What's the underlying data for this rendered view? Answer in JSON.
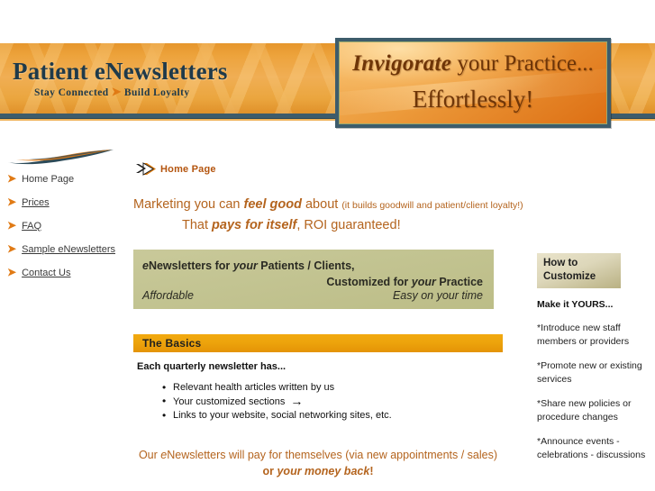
{
  "banner": {
    "brand_title": "Patient eNewsletters",
    "tagline_left": "Stay Connected",
    "tagline_sep": "➤",
    "tagline_right": "Build Loyalty",
    "plaque_line1_em": "Invigorate",
    "plaque_line1_rest": " your Practice...",
    "plaque_line2": "Effortlessly!",
    "colors": {
      "banner_orange": "#eda33c",
      "banner_border_blue": "#3d5c6b",
      "plaque_orange": "#dd6f14"
    }
  },
  "sidebar": {
    "items": [
      {
        "label": "Home Page",
        "current": true
      },
      {
        "label": "Prices",
        "current": false
      },
      {
        "label": "FAQ",
        "current": false
      },
      {
        "label": "Sample eNewsletters",
        "current": false
      },
      {
        "label": "Contact Us",
        "current": false
      }
    ],
    "arrow_glyph": "➤"
  },
  "main": {
    "breadcrumb": "Home Page",
    "headline": {
      "row1_a": "Marketing you can ",
      "row1_em": "feel good",
      "row1_b": " about ",
      "row1_small": "(it builds goodwill and patient/client loyalty!)",
      "row2_a": "That ",
      "row2_em": "pays for itself",
      "row2_b": ", ROI guaranteed!"
    },
    "olive_box": {
      "line1_a": "e",
      "line1_b": "Newsletters for ",
      "line1_em": "your",
      "line1_c": " Patients / Clients,",
      "line2_a": "Customized for ",
      "line2_em": "your",
      "line2_b": " Practice",
      "sub_left": "Affordable",
      "sub_right": "Easy on your time"
    },
    "basics": {
      "bar_title": "The Basics",
      "subtitle": "Each quarterly newsletter has...",
      "items": [
        {
          "text": "Relevant health articles written by us",
          "arrow": false
        },
        {
          "text": "Your customized sections",
          "arrow": true
        },
        {
          "text": "Links to your website, social networking sites, etc.",
          "arrow": false
        }
      ],
      "arrow_glyph": "→"
    },
    "footer_pitch": {
      "line1_a": "Our ",
      "line1_em": "e",
      "line1_b": "Newsletters will pay for themselves (via new appointments / sales)",
      "line2_a": "or ",
      "line2_em": "your money back",
      "line2_b": "!"
    }
  },
  "right_column": {
    "heading_line1": "How to",
    "heading_line2": "Customize",
    "subheading": "Make it YOURS...",
    "items": [
      "*Introduce new staff members or providers",
      "*Promote new or existing services",
      "*Share new policies or procedure changes",
      "*Announce events - celebrations - discussions"
    ]
  }
}
